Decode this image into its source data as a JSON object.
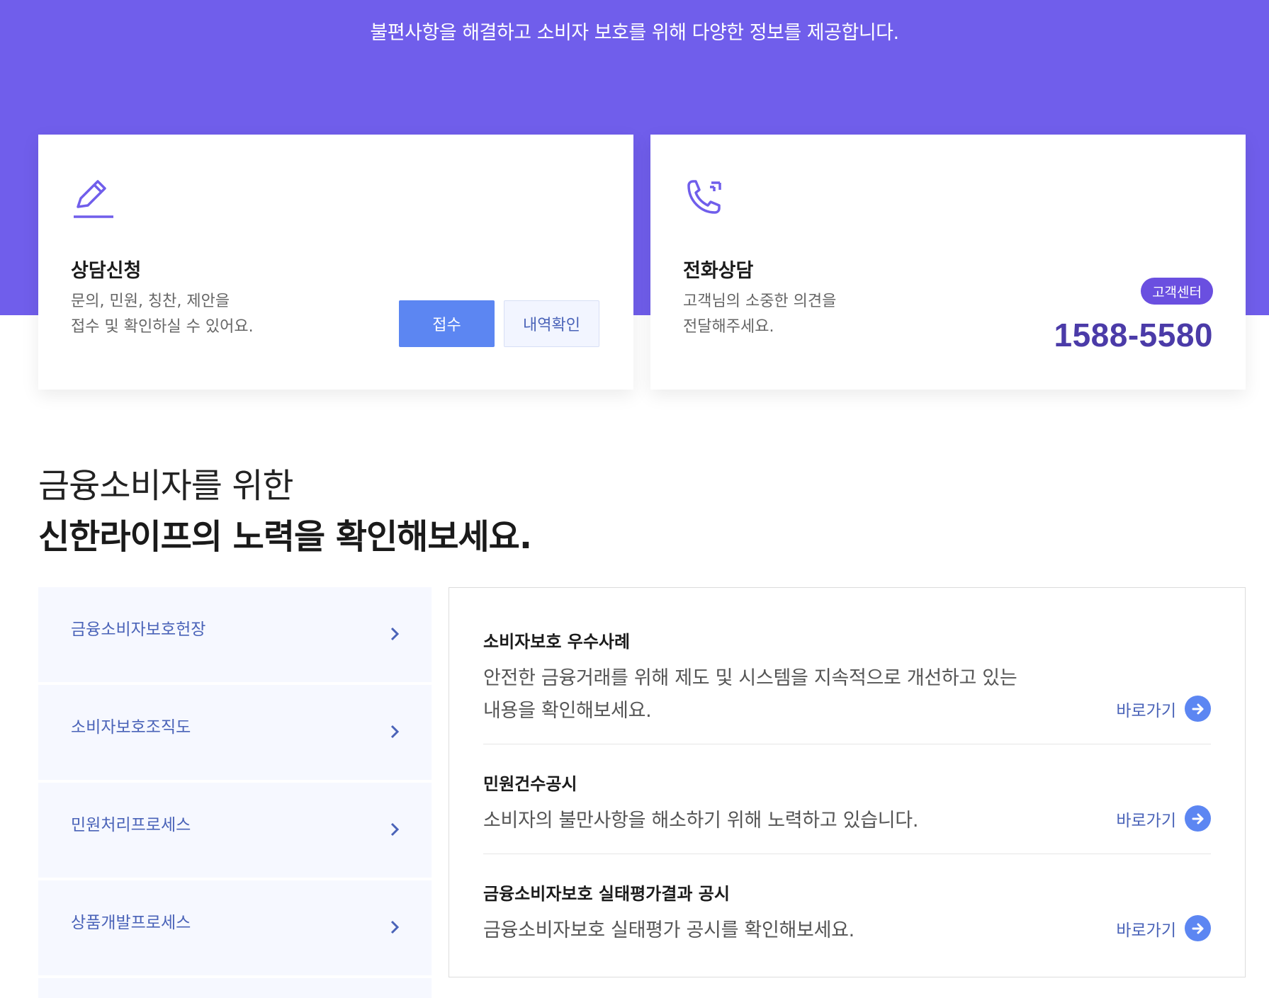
{
  "hero": {
    "subtitle": "불편사항을 해결하고 소비자 보호를 위해 다양한 정보를 제공합니다."
  },
  "cards": {
    "consult": {
      "icon": "pencil-icon",
      "title": "상담신청",
      "desc": "문의, 민원, 칭찬, 제안을\n접수 및 확인하실 수 있어요.",
      "submit_label": "접수",
      "history_label": "내역확인"
    },
    "phone": {
      "icon": "phone-call-icon",
      "title": "전화상담",
      "desc": "고객님의 소중한 의견을\n전달해주세요.",
      "badge": "고객센터",
      "number": "1588-5580"
    }
  },
  "section": {
    "title_line1": "금융소비자를 위한",
    "title_line2": "신한라이프의 노력을 확인해보세요."
  },
  "menu": {
    "items": [
      {
        "label": "금융소비자보호헌장"
      },
      {
        "label": "소비자보호조직도"
      },
      {
        "label": "민원처리프로세스"
      },
      {
        "label": "상품개발프로세스"
      }
    ]
  },
  "content": {
    "rows": [
      {
        "title": "소비자보호 우수사례",
        "desc": "안전한 금융거래를 위해 제도 및 시스템을 지속적으로 개선하고 있는\n내용을 확인해보세요.",
        "link": "바로가기"
      },
      {
        "title": "민원건수공시",
        "desc": "소비자의 불만사항을 해소하기 위해 노력하고 있습니다.",
        "link": "바로가기"
      },
      {
        "title": "금융소비자보호 실태평가결과 공시",
        "desc": "금융소비자보호 실태평가 공시를 확인해보세요.",
        "link": "바로가기"
      }
    ]
  },
  "colors": {
    "hero_bg": "#705eeb",
    "primary_button": "#5c86f2",
    "phone_number": "#4b3ba8",
    "badge": "#6a4fe0",
    "menu_text": "#4a63b8"
  }
}
